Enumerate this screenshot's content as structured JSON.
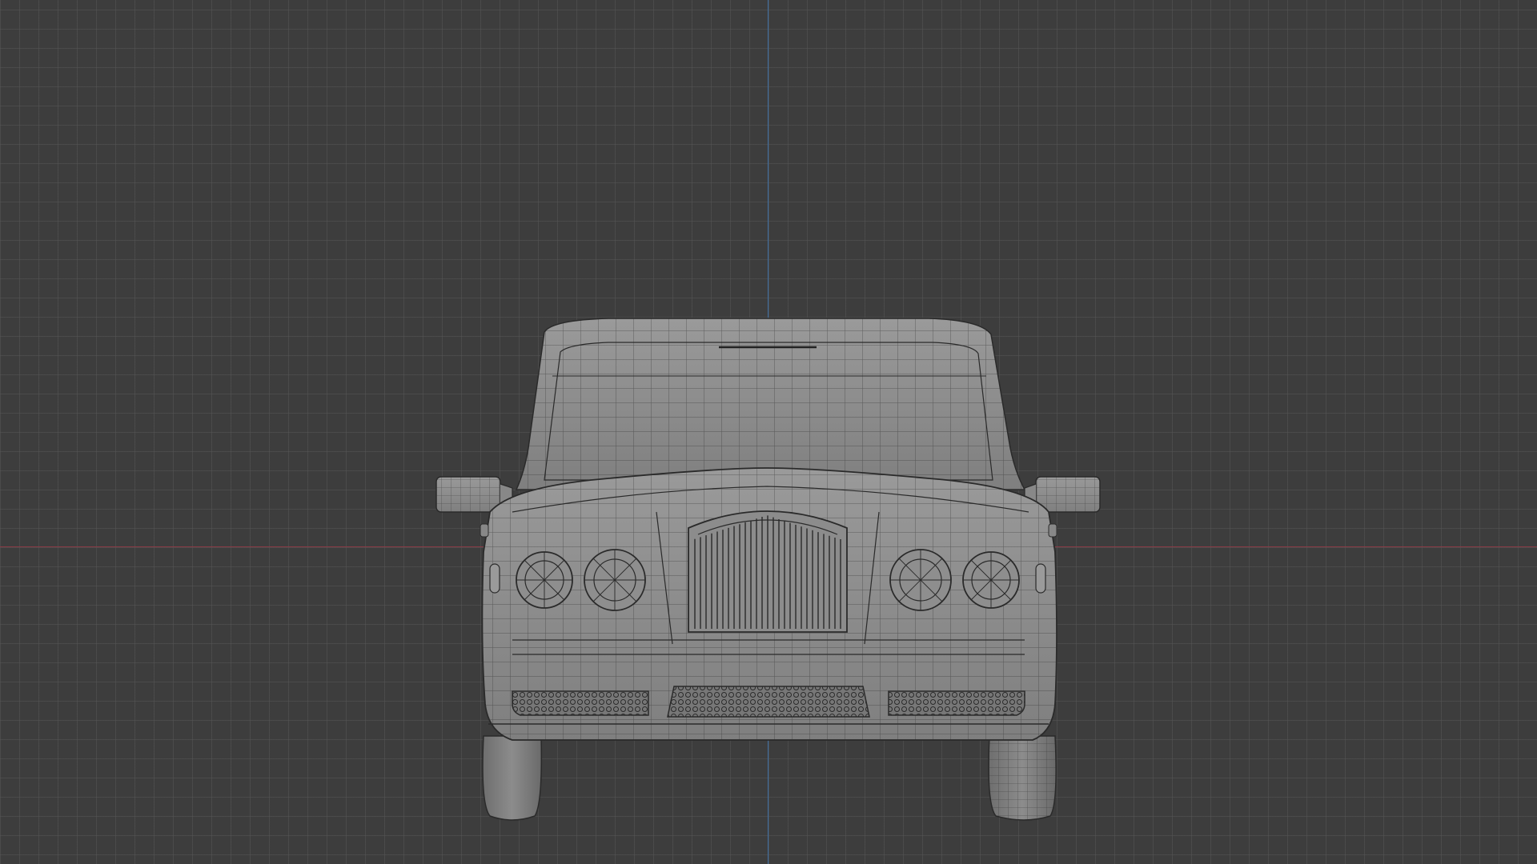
{
  "viewport": {
    "background_color": "#3d3d3d",
    "grid_color": "#555555",
    "x_axis_color": "#8a3b45",
    "z_axis_color": "#3f6fa3"
  },
  "model": {
    "object": "car-front-view",
    "display_mode": "wireframe-on-shaded",
    "body_color": "#8f8f8f",
    "edge_color": "#2a2a2a"
  }
}
